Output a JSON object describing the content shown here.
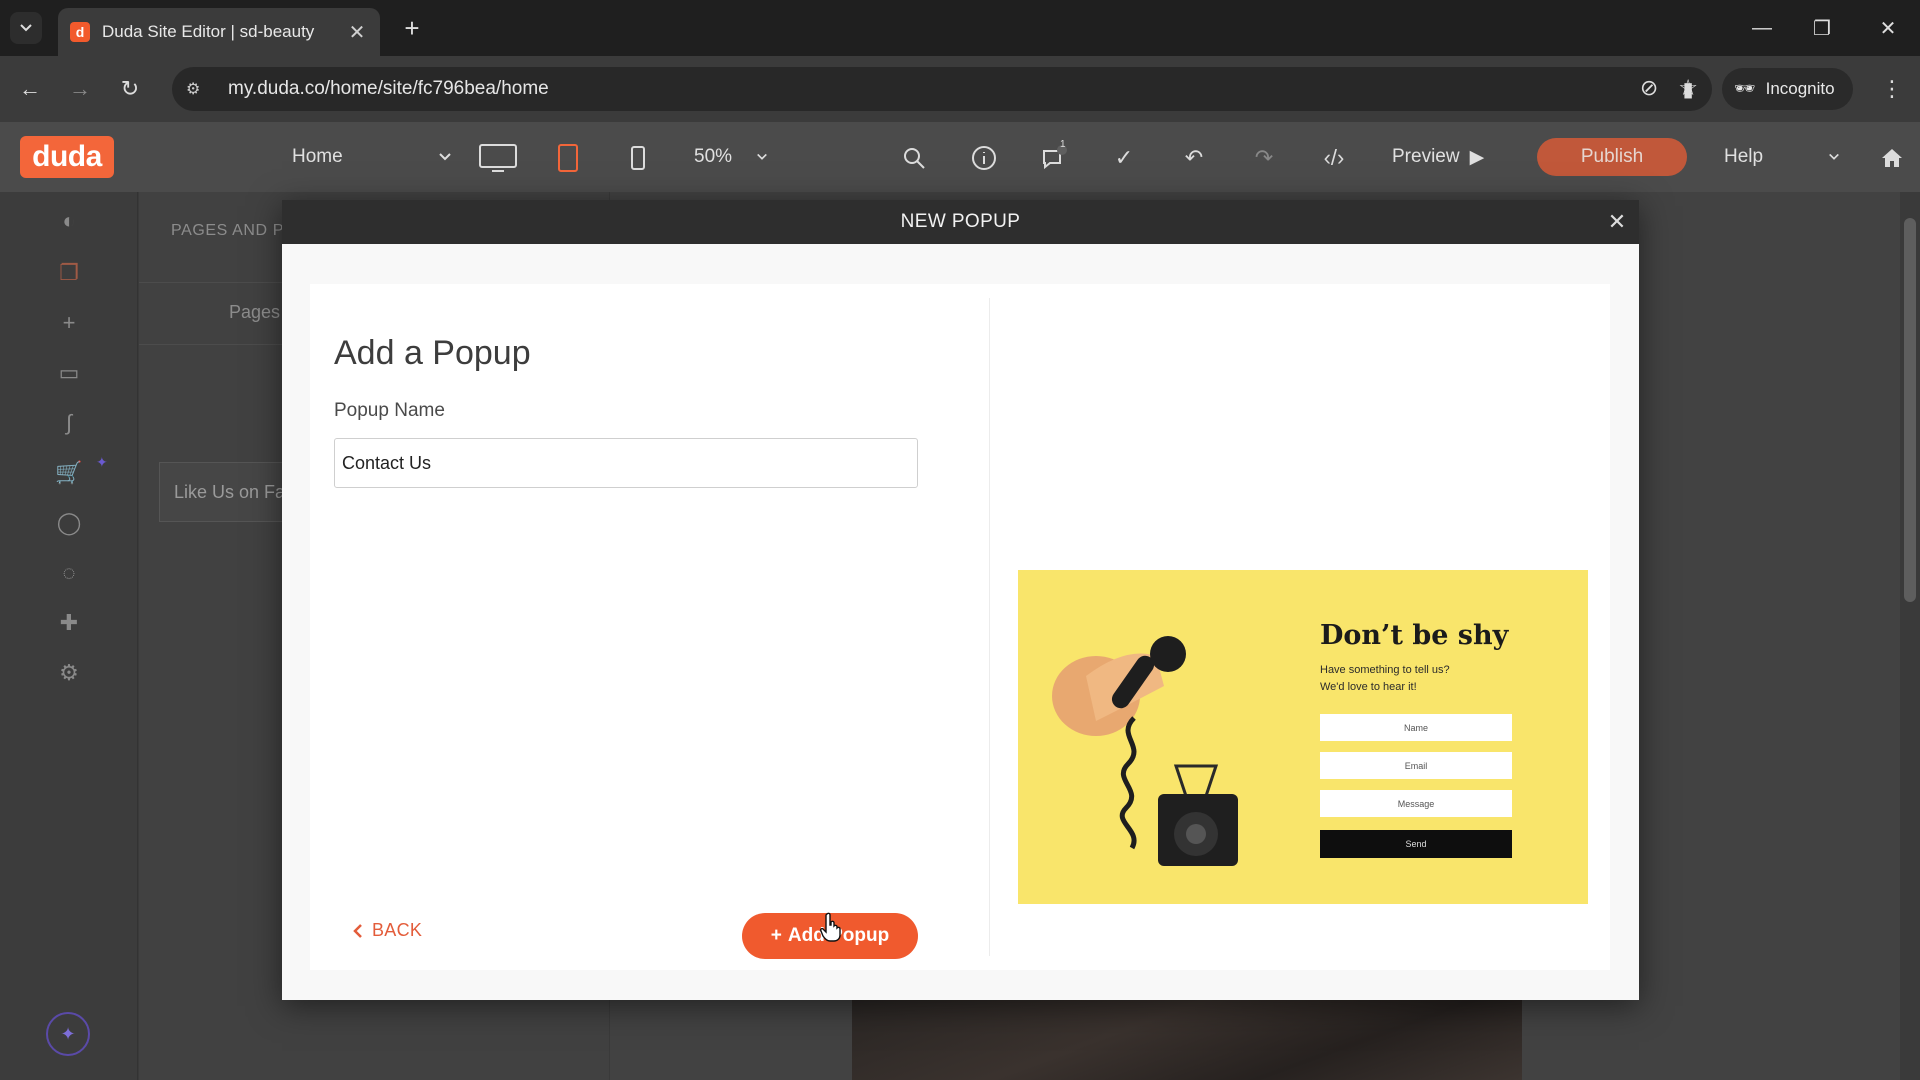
{
  "browser": {
    "tab_title": "Duda Site Editor | sd-beauty",
    "favicon_letter": "d",
    "url": "my.duda.co/home/site/fc796bea/home",
    "incognito_label": "Incognito"
  },
  "toolbar": {
    "logo": "duda",
    "page_select": "Home",
    "zoom": "50%",
    "notification_count": "1",
    "preview_label": "Preview",
    "publish_label": "Publish",
    "help_label": "Help"
  },
  "panel": {
    "title": "PAGES AND P",
    "tab_pages": "Pages",
    "popup_item": "Like Us on Fa"
  },
  "modal": {
    "title": "NEW POPUP",
    "heading": "Add a Popup",
    "name_label": "Popup Name",
    "name_value": "Contact Us",
    "back_label": "BACK",
    "add_label": "Add Popup",
    "add_icon": "+"
  },
  "preview": {
    "title": "Don’t be shy",
    "subtitle_line1": "Have something to tell us?",
    "subtitle_line2": "We'd love to hear it!",
    "field_name": "Name",
    "field_email": "Email",
    "field_message": "Message",
    "send_label": "Send",
    "bg_color": "#f9e56b"
  },
  "colors": {
    "accent": "#f05a2e",
    "modal_header": "#2e2e2e"
  }
}
